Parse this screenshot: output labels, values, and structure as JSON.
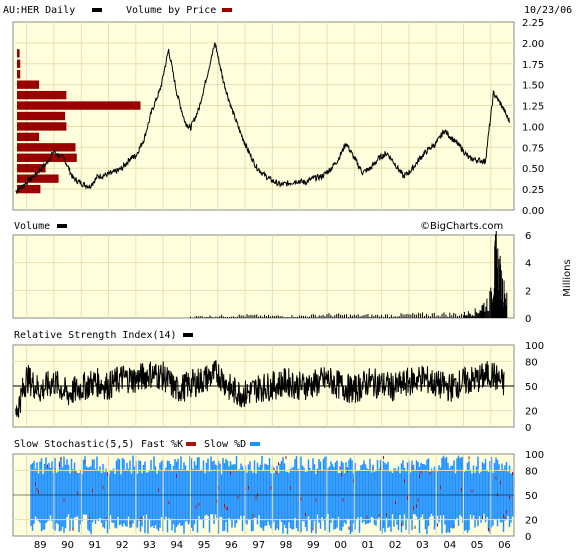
{
  "header": {
    "symbol_label": "AU:HER Daily",
    "vbp_label": "Volume by Price",
    "date": "10/23/06"
  },
  "volume_panel": {
    "title": "Volume",
    "watermark": "©BigCharts.com",
    "unit_label": "Millions"
  },
  "rsi_panel": {
    "title": "Relative Strength Index(14)"
  },
  "stoch_panel": {
    "title": "Slow Stochastic(5,5)",
    "fast_label": "Fast %K",
    "slow_label": "Slow %D"
  },
  "colors": {
    "panel_bg": "#ffffdd",
    "grid": "#e6e0b0",
    "price_line": "#000000",
    "volume_by_price": "#990000",
    "stoch_d": "#1e90ff",
    "stoch_k": "#aa1111"
  },
  "chart_data": [
    {
      "type": "line",
      "title": "AU:HER Daily",
      "x_tick_labels": [
        "89",
        "90",
        "91",
        "92",
        "93",
        "94",
        "95",
        "96",
        "97",
        "98",
        "99",
        "00",
        "01",
        "02",
        "03",
        "04",
        "05",
        "06"
      ],
      "y_tick_labels": [
        "0.00",
        "0.25",
        "0.50",
        "0.75",
        "1.00",
        "1.25",
        "1.50",
        "1.75",
        "2.00",
        "2.25"
      ],
      "ylim": [
        0,
        2.25
      ],
      "series": [
        {
          "name": "AU:HER Daily",
          "x": [
            1988.6,
            1988.9,
            1989.3,
            1989.7,
            1990.0,
            1990.4,
            1990.7,
            1991.0,
            1991.3,
            1991.6,
            1991.9,
            1992.2,
            1992.5,
            1992.8,
            1993.0,
            1993.3,
            1993.6,
            1993.9,
            1994.2,
            1994.5,
            1994.8,
            1995.0,
            1995.3,
            1995.6,
            1995.9,
            1996.2,
            1996.5,
            1996.8,
            1997.1,
            1997.4,
            1997.7,
            1998.0,
            1998.3,
            1998.6,
            1998.9,
            1999.2,
            1999.5,
            1999.8,
            2000.1,
            2000.4,
            2000.7,
            2001.0,
            2001.3,
            2001.6,
            2001.9,
            2002.2,
            2002.5,
            2002.8,
            2003.1,
            2003.4,
            2003.7,
            2004.0,
            2004.3,
            2004.6,
            2004.9,
            2005.2,
            2005.5,
            2005.8,
            2006.1,
            2006.4,
            2006.7
          ],
          "y": [
            0.22,
            0.3,
            0.42,
            0.55,
            0.7,
            0.6,
            0.38,
            0.32,
            0.28,
            0.4,
            0.42,
            0.45,
            0.5,
            0.62,
            0.65,
            0.85,
            1.2,
            1.45,
            1.92,
            1.4,
            1.05,
            0.98,
            1.2,
            1.6,
            2.0,
            1.55,
            1.22,
            0.95,
            0.72,
            0.52,
            0.42,
            0.35,
            0.3,
            0.32,
            0.35,
            0.33,
            0.38,
            0.4,
            0.48,
            0.6,
            0.8,
            0.62,
            0.45,
            0.5,
            0.62,
            0.68,
            0.55,
            0.4,
            0.48,
            0.62,
            0.72,
            0.8,
            0.95,
            0.85,
            0.75,
            0.62,
            0.6,
            0.58,
            1.4,
            1.25,
            1.05
          ]
        }
      ],
      "volume_by_price": {
        "price_mid": [
          0.25,
          0.375,
          0.5,
          0.625,
          0.75,
          0.875,
          1.0,
          1.125,
          1.25,
          1.375,
          1.5,
          1.625,
          1.75,
          1.875
        ],
        "relative_volume": [
          0.18,
          0.32,
          0.22,
          0.46,
          0.45,
          0.17,
          0.38,
          0.37,
          0.95,
          0.38,
          0.17,
          0.025,
          0.025,
          0.02
        ]
      }
    },
    {
      "type": "bar",
      "title": "Volume",
      "ylabel": "Millions",
      "y_tick_labels": [
        "0",
        "2",
        "4",
        "6"
      ],
      "ylim": [
        0,
        6
      ],
      "series": [
        {
          "name": "Volume",
          "x": [
            1995.0,
            1996.0,
            1997.0,
            1998.0,
            1999.0,
            2000.0,
            2001.0,
            2002.0,
            2003.0,
            2004.0,
            2005.0,
            2005.5,
            2006.0,
            2006.2,
            2006.4,
            2006.6
          ],
          "values": [
            0.1,
            0.15,
            0.2,
            0.15,
            0.15,
            0.25,
            0.2,
            0.2,
            0.25,
            0.3,
            0.3,
            0.5,
            1.5,
            4.5,
            2.5,
            1.2
          ]
        }
      ]
    },
    {
      "type": "line",
      "title": "Relative Strength Index(14)",
      "y_tick_labels": [
        "0",
        "20",
        "50",
        "80",
        "100"
      ],
      "ylim": [
        0,
        100
      ],
      "series": [
        {
          "name": "Relative Strength Index(14)",
          "x": [
            1988.6,
            1989.0,
            1989.5,
            1990.0,
            1990.5,
            1991.0,
            1991.5,
            1992.0,
            1992.5,
            1993.0,
            1993.5,
            1994.0,
            1994.5,
            1995.0,
            1995.5,
            1996.0,
            1996.5,
            1997.0,
            1997.5,
            1998.0,
            1998.5,
            1999.0,
            1999.5,
            2000.0,
            2000.5,
            2001.0,
            2001.5,
            2002.0,
            2002.5,
            2003.0,
            2003.5,
            2004.0,
            2004.5,
            2005.0,
            2005.5,
            2006.0,
            2006.5
          ],
          "y": [
            15,
            60,
            45,
            55,
            40,
            48,
            55,
            50,
            60,
            58,
            65,
            62,
            45,
            52,
            58,
            66,
            45,
            40,
            48,
            50,
            55,
            50,
            52,
            58,
            50,
            45,
            55,
            52,
            48,
            55,
            60,
            52,
            48,
            55,
            58,
            65,
            52
          ]
        }
      ]
    },
    {
      "type": "line",
      "title": "Slow Stochastic(5,5)",
      "y_tick_labels": [
        "0",
        "20",
        "50",
        "80",
        "100"
      ],
      "ylim": [
        0,
        100
      ],
      "series": [
        {
          "name": "Fast %K",
          "x": [
            1989.0,
            1990.0,
            1991.0,
            1992.0,
            1993.0,
            1994.0,
            1995.0,
            1996.0,
            1997.0,
            1998.0,
            1999.0,
            2000.0,
            2001.0,
            2002.0,
            2003.0,
            2004.0,
            2005.0,
            2006.0
          ],
          "y": [
            80,
            20,
            75,
            30,
            85,
            25,
            80,
            20,
            70,
            30,
            75,
            25,
            80,
            35,
            70,
            30,
            75,
            60
          ]
        },
        {
          "name": "Slow %D",
          "x": [
            1989.0,
            1990.0,
            1991.0,
            1992.0,
            1993.0,
            1994.0,
            1995.0,
            1996.0,
            1997.0,
            1998.0,
            1999.0,
            2000.0,
            2001.0,
            2002.0,
            2003.0,
            2004.0,
            2005.0,
            2006.0
          ],
          "y": [
            70,
            30,
            65,
            35,
            75,
            30,
            70,
            30,
            65,
            35,
            65,
            30,
            70,
            40,
            65,
            35,
            65,
            55
          ]
        }
      ]
    }
  ]
}
